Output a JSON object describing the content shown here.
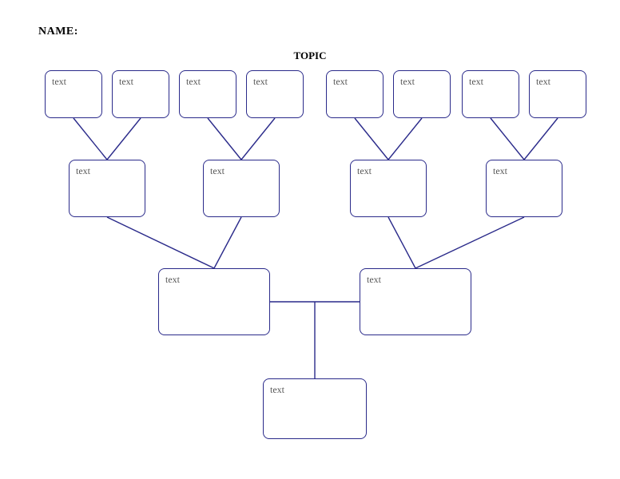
{
  "header": {
    "name_label": "NAME:",
    "topic_label": "TOPIC"
  },
  "row1": [
    {
      "text": "text"
    },
    {
      "text": "text"
    },
    {
      "text": "text"
    },
    {
      "text": "text"
    },
    {
      "text": "text"
    },
    {
      "text": "text"
    },
    {
      "text": "text"
    },
    {
      "text": "text"
    }
  ],
  "row2": [
    {
      "text": "text"
    },
    {
      "text": "text"
    },
    {
      "text": "text"
    },
    {
      "text": "text"
    }
  ],
  "row3": [
    {
      "text": "text"
    },
    {
      "text": "text"
    }
  ],
  "row4": [
    {
      "text": "text"
    }
  ],
  "colors": {
    "stroke": "#2a2a8a",
    "background": "#ffffff"
  }
}
